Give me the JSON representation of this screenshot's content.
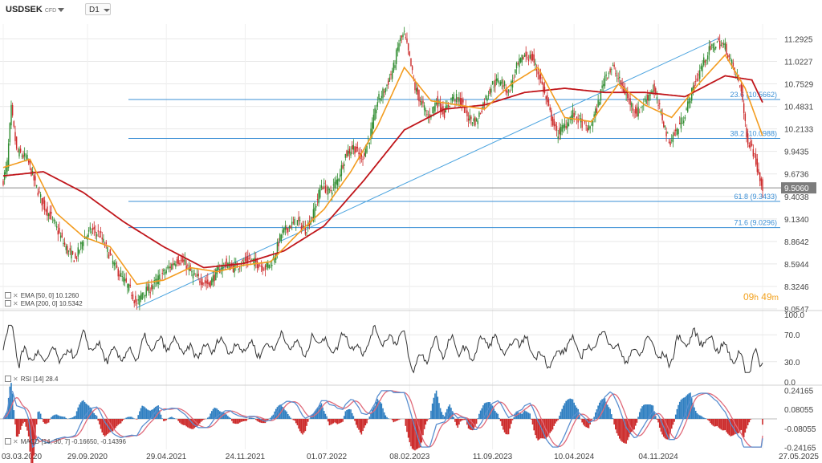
{
  "header": {
    "symbol": "USDSEK",
    "instrument_type": "CFD",
    "timeframe": "D1"
  },
  "legend": {
    "ema50": "EMA [50, 0] 10.1260",
    "ema200": "EMA [200, 0] 10.5342",
    "rsi": "RSI [14] 28.4",
    "macd": "MACD [14, 30, 7] -0.16650, -0.14396"
  },
  "timer": {
    "hours": "09",
    "h": "h",
    "minutes": "49",
    "m": "m"
  },
  "colors": {
    "up": "#2e8b2e",
    "down": "#cc2a2a",
    "ema50": "#f39c1f",
    "ema200": "#c0161b",
    "fib": "#3a8fd6",
    "trend": "#4aa3df",
    "price_tag": "#7c7c7c",
    "grid": "#e8e8e8",
    "macd_pos": "#2f7fc1",
    "macd_neg": "#cc2a2a",
    "rsi": "#333333"
  },
  "chart_data": [
    {
      "type": "candlestick",
      "name_panel": "price",
      "y_ticks": [
        "11.2925",
        "11.0227",
        "10.7529",
        "10.4831",
        "10.2133",
        "9.9435",
        "9.6736",
        "9.4038",
        "9.1340",
        "8.8642",
        "8.5944",
        "8.3246",
        "8.0547"
      ],
      "ylim": [
        8.0547,
        11.47
      ],
      "x_ticks": [
        "03.03.2020",
        "29.09.2020",
        "29.04.2021",
        "24.11.2021",
        "01.07.2022",
        "08.02.2023",
        "11.09.2023",
        "10.04.2024",
        "04.11.2024",
        "27.05.2025"
      ],
      "current_price": "9.5060",
      "fib_levels": [
        {
          "pct": "23.6",
          "value": "10.5662",
          "label": "23.6 (10.5662)"
        },
        {
          "pct": "38.2",
          "value": "10.0988",
          "label": "38.2 (10.0988)"
        },
        {
          "pct": "61.8",
          "value": "9.3433",
          "label": "61.8 (9.3433)"
        },
        {
          "pct": "71.6",
          "value": "9.0296",
          "label": "71.6 (9.0296)"
        }
      ],
      "trendline": {
        "from": [
          "29.09.2020",
          8.07
        ],
        "to": [
          "04.11.2024",
          11.3
        ]
      },
      "price_path": [
        [
          0,
          9.6
        ],
        [
          3,
          9.8
        ],
        [
          6,
          10.45
        ],
        [
          10,
          9.95
        ],
        [
          14,
          9.9
        ],
        [
          18,
          9.85
        ],
        [
          24,
          9.55
        ],
        [
          30,
          9.3
        ],
        [
          36,
          9.15
        ],
        [
          42,
          8.95
        ],
        [
          48,
          8.75
        ],
        [
          54,
          8.65
        ],
        [
          60,
          8.9
        ],
        [
          66,
          9.0
        ],
        [
          72,
          8.95
        ],
        [
          78,
          8.75
        ],
        [
          84,
          8.55
        ],
        [
          90,
          8.4
        ],
        [
          96,
          8.25
        ],
        [
          100,
          8.1
        ],
        [
          104,
          8.25
        ],
        [
          110,
          8.3
        ],
        [
          118,
          8.45
        ],
        [
          124,
          8.55
        ],
        [
          130,
          8.65
        ],
        [
          136,
          8.6
        ],
        [
          142,
          8.45
        ],
        [
          148,
          8.4
        ],
        [
          154,
          8.35
        ],
        [
          160,
          8.5
        ],
        [
          166,
          8.6
        ],
        [
          172,
          8.55
        ],
        [
          178,
          8.6
        ],
        [
          184,
          8.65
        ],
        [
          190,
          8.6
        ],
        [
          196,
          8.55
        ],
        [
          202,
          8.65
        ],
        [
          208,
          8.95
        ],
        [
          214,
          9.05
        ],
        [
          220,
          9.1
        ],
        [
          226,
          9.0
        ],
        [
          232,
          9.2
        ],
        [
          238,
          9.55
        ],
        [
          244,
          9.45
        ],
        [
          250,
          9.6
        ],
        [
          256,
          9.9
        ],
        [
          262,
          10.0
        ],
        [
          268,
          9.85
        ],
        [
          274,
          10.1
        ],
        [
          280,
          10.55
        ],
        [
          286,
          10.7
        ],
        [
          292,
          10.95
        ],
        [
          296,
          11.25
        ],
        [
          300,
          11.35
        ],
        [
          304,
          11.05
        ],
        [
          308,
          10.7
        ],
        [
          312,
          10.55
        ],
        [
          318,
          10.35
        ],
        [
          324,
          10.55
        ],
        [
          330,
          10.4
        ],
        [
          336,
          10.6
        ],
        [
          342,
          10.55
        ],
        [
          348,
          10.35
        ],
        [
          354,
          10.3
        ],
        [
          360,
          10.55
        ],
        [
          366,
          10.75
        ],
        [
          372,
          10.8
        ],
        [
          378,
          10.65
        ],
        [
          384,
          10.95
        ],
        [
          390,
          11.1
        ],
        [
          396,
          11.05
        ],
        [
          402,
          10.8
        ],
        [
          408,
          10.45
        ],
        [
          414,
          10.15
        ],
        [
          420,
          10.25
        ],
        [
          426,
          10.4
        ],
        [
          432,
          10.3
        ],
        [
          438,
          10.2
        ],
        [
          444,
          10.45
        ],
        [
          450,
          10.85
        ],
        [
          456,
          10.95
        ],
        [
          462,
          10.75
        ],
        [
          468,
          10.55
        ],
        [
          474,
          10.4
        ],
        [
          480,
          10.55
        ],
        [
          486,
          10.7
        ],
        [
          492,
          10.4
        ],
        [
          498,
          10.05
        ],
        [
          504,
          10.2
        ],
        [
          510,
          10.4
        ],
        [
          516,
          10.7
        ],
        [
          522,
          10.95
        ],
        [
          528,
          11.15
        ],
        [
          534,
          11.25
        ],
        [
          540,
          11.2
        ],
        [
          546,
          10.95
        ],
        [
          552,
          10.7
        ],
        [
          556,
          10.1
        ],
        [
          560,
          10.0
        ],
        [
          564,
          9.75
        ],
        [
          568,
          9.52
        ]
      ],
      "ema50_path": [
        [
          0,
          9.75
        ],
        [
          20,
          9.85
        ],
        [
          40,
          9.2
        ],
        [
          60,
          8.92
        ],
        [
          80,
          8.8
        ],
        [
          100,
          8.35
        ],
        [
          120,
          8.4
        ],
        [
          140,
          8.55
        ],
        [
          160,
          8.5
        ],
        [
          180,
          8.58
        ],
        [
          200,
          8.62
        ],
        [
          220,
          8.95
        ],
        [
          240,
          9.25
        ],
        [
          260,
          9.7
        ],
        [
          280,
          10.25
        ],
        [
          300,
          10.95
        ],
        [
          320,
          10.55
        ],
        [
          340,
          10.5
        ],
        [
          360,
          10.45
        ],
        [
          380,
          10.75
        ],
        [
          400,
          10.95
        ],
        [
          420,
          10.35
        ],
        [
          440,
          10.3
        ],
        [
          460,
          10.75
        ],
        [
          480,
          10.5
        ],
        [
          500,
          10.35
        ],
        [
          520,
          10.75
        ],
        [
          540,
          11.1
        ],
        [
          555,
          10.7
        ],
        [
          568,
          10.13
        ]
      ],
      "ema200_path": [
        [
          0,
          9.65
        ],
        [
          30,
          9.7
        ],
        [
          60,
          9.45
        ],
        [
          90,
          9.1
        ],
        [
          120,
          8.8
        ],
        [
          150,
          8.55
        ],
        [
          180,
          8.6
        ],
        [
          210,
          8.75
        ],
        [
          240,
          9.05
        ],
        [
          270,
          9.6
        ],
        [
          300,
          10.2
        ],
        [
          330,
          10.45
        ],
        [
          360,
          10.5
        ],
        [
          390,
          10.65
        ],
        [
          420,
          10.7
        ],
        [
          450,
          10.65
        ],
        [
          480,
          10.65
        ],
        [
          510,
          10.6
        ],
        [
          540,
          10.85
        ],
        [
          560,
          10.8
        ],
        [
          568,
          10.53
        ]
      ]
    },
    {
      "type": "line",
      "name_panel": "rsi",
      "y_ticks": [
        "100.0",
        "70.0",
        "30.0",
        "0.0"
      ],
      "ylim": [
        0,
        100
      ],
      "last_value": 28.4
    },
    {
      "type": "histogram_line",
      "name_panel": "macd",
      "y_ticks": [
        "0.24165",
        "0.08055",
        "-0.08055",
        "-0.24165"
      ],
      "ylim": [
        -0.26,
        0.26
      ],
      "last_values": [
        -0.1665,
        -0.14396
      ]
    }
  ]
}
